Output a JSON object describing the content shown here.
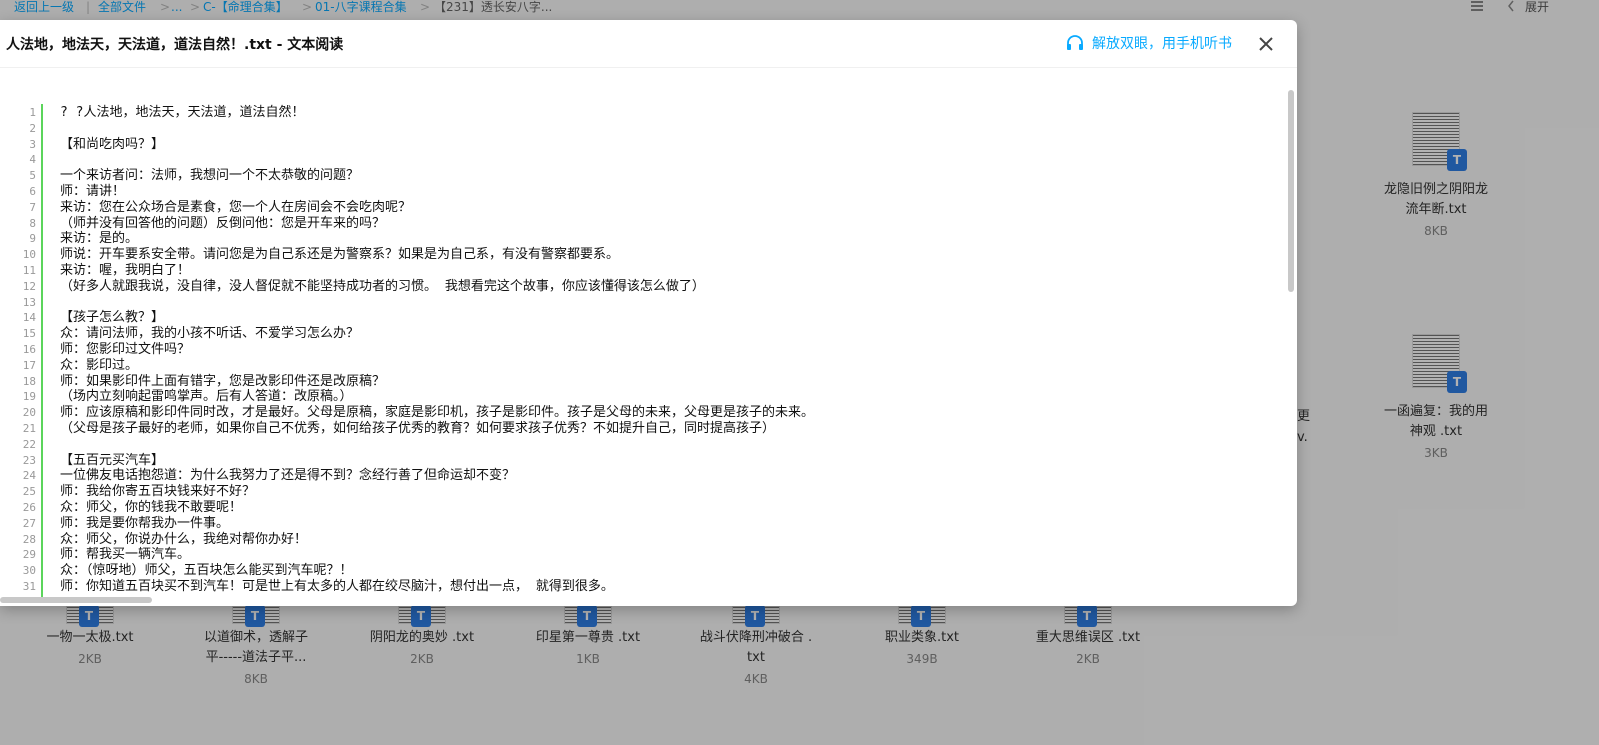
{
  "breadcrumb": {
    "back": "返回上一级",
    "sep": "|",
    "all_files": "全部文件",
    "gt": ">",
    "ellipsis": "...",
    "c_folder": "C-【命理合集】",
    "folder_01": "01-八字课程合集",
    "current": "【231】透长安八字..."
  },
  "topright": {
    "expand": "展开"
  },
  "right_files": [
    {
      "name1": "龙隐旧例之阴阳龙",
      "name2": "流年断.txt",
      "size": "8KB",
      "badge": "T"
    },
    {
      "name1": "一函遍复：我的用",
      "name2": "神观 .txt",
      "size": "3KB",
      "badge": "T"
    }
  ],
  "partial_text": {
    "a": "更",
    "b": "v."
  },
  "bottom_files": [
    {
      "name1": "一物一太极.txt",
      "name2": "",
      "size": "2KB",
      "badge": "T"
    },
    {
      "name1": "以道御术，透解子",
      "name2": "平-----道法子平...",
      "size": "8KB",
      "badge": "T"
    },
    {
      "name1": "阴阳龙的奥妙 .txt",
      "name2": "",
      "size": "2KB",
      "badge": "T"
    },
    {
      "name1": "印星第一尊贵 .txt",
      "name2": "",
      "size": "1KB",
      "badge": "T"
    },
    {
      "name1": "战斗伏降刑冲破合 .",
      "name2": "txt",
      "size": "4KB",
      "badge": "T"
    },
    {
      "name1": "职业类象.txt",
      "name2": "",
      "size": "349B",
      "badge": "T"
    },
    {
      "name1": "重大思维误区 .txt",
      "name2": "",
      "size": "2KB",
      "badge": "T"
    }
  ],
  "modal": {
    "title": "人法地，地法天，天法道，道法自然！.txt - 文本阅读",
    "listen": "解放双眼，用手机听书"
  },
  "lines": [
    {
      "n": "1",
      "t": "? ?人法地，地法天，天法道，道法自然！"
    },
    {
      "n": "2",
      "t": ""
    },
    {
      "n": "3",
      "t": "【和尚吃肉吗？】"
    },
    {
      "n": "4",
      "t": ""
    },
    {
      "n": "5",
      "t": "一个来访者问：法师，我想问一个不太恭敬的问题？"
    },
    {
      "n": "6",
      "t": "师：请讲！"
    },
    {
      "n": "7",
      "t": "来访：您在公众场合是素食，您一个人在房间会不会吃肉呢？"
    },
    {
      "n": "8",
      "t": "（师并没有回答他的问题）反倒问他：您是开车来的吗？"
    },
    {
      "n": "9",
      "t": "来访：是的。"
    },
    {
      "n": "10",
      "t": "师说：开车要系安全带。请问您是为自己系还是为警察系？如果是为自己系，有没有警察都要系。"
    },
    {
      "n": "11",
      "t": "来访：喔，我明白了！"
    },
    {
      "n": "12",
      "t": "（好多人就跟我说，没自律，没人督促就不能坚持成功者的习惯。 我想看完这个故事，你应该懂得该怎么做了）"
    },
    {
      "n": "13",
      "t": ""
    },
    {
      "n": "14",
      "t": "【孩子怎么教？】"
    },
    {
      "n": "15",
      "t": "众：请问法师，我的小孩不听话、不爱学习怎么办？"
    },
    {
      "n": "16",
      "t": "师：您影印过文件吗？"
    },
    {
      "n": "17",
      "t": "众：影印过。"
    },
    {
      "n": "18",
      "t": "师：如果影印件上面有错字，您是改影印件还是改原稿？"
    },
    {
      "n": "19",
      "t": "（场内立刻响起雷鸣掌声。后有人答道：改原稿。）"
    },
    {
      "n": "20",
      "t": "师：应该原稿和影印件同时改，才是最好。父母是原稿，家庭是影印机，孩子是影印件。孩子是父母的未来，父母更是孩子的未来。"
    },
    {
      "n": "21",
      "t": "（父母是孩子最好的老师，如果你自己不优秀，如何给孩子优秀的教育？如何要求孩子优秀？不如提升自己，同时提高孩子）"
    },
    {
      "n": "22",
      "t": ""
    },
    {
      "n": "23",
      "t": "【五百元买汽车】"
    },
    {
      "n": "24",
      "t": "一位佛友电话抱怨道：为什么我努力了还是得不到？念经行善了但命运却不变？"
    },
    {
      "n": "25",
      "t": "师：我给你寄五百块钱来好不好？"
    },
    {
      "n": "26",
      "t": "众：师父，你的钱我不敢要呢！"
    },
    {
      "n": "27",
      "t": "师：我是要你帮我办一件事。"
    },
    {
      "n": "28",
      "t": "众：师父，你说办什么，我绝对帮你办好！"
    },
    {
      "n": "29",
      "t": "师：帮我买一辆汽车。"
    },
    {
      "n": "30",
      "t": "众：（惊呀地）师父，五百块怎么能买到汽车呢？！"
    },
    {
      "n": "31",
      "t": "师：你知道五百块买不到汽车！可是世上有太多的人都在绞尽脑汁，想付出一点， 就得到很多。"
    }
  ],
  "colors": {
    "accent": "#09aaff",
    "gutter_line": "#5bd55b",
    "badge": "#2f7ee6"
  },
  "icons": {
    "listen": "headphones-icon",
    "close": "close-icon",
    "list_view": "list-view-icon",
    "expand": "chevron-left-icon"
  }
}
